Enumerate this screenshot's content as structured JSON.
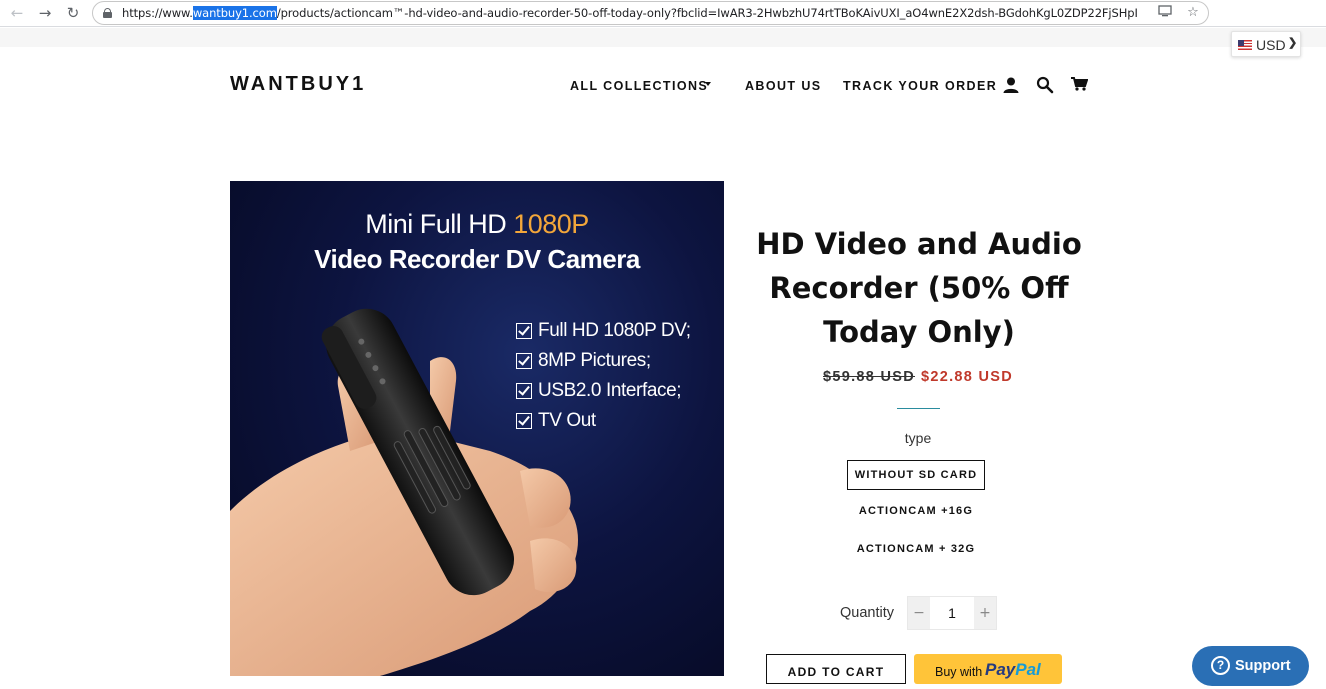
{
  "browser": {
    "url_prefix": "https://www.",
    "url_highlight": "wantbuy1.com",
    "url_rest": "/products/actioncam™-hd-video-and-audio-recorder-50-off-today-only?fbclid=IwAR3-2HwbzhU74rtTBoKAivUXI_aO4wnE2X2dsh-BGdohKgL0ZDP22FjSHpI",
    "icons": {
      "back": "arrow-left-icon",
      "forward": "arrow-right-icon",
      "reload": "reload-icon",
      "lock": "lock-icon",
      "cast": "cast-icon",
      "bookmark": "star-icon"
    }
  },
  "currency": {
    "label": "USD",
    "flag": "us-flag-icon"
  },
  "header": {
    "logo": "WANTBUY1",
    "nav": {
      "collections": "ALL COLLECTIONS",
      "about": "ABOUT US",
      "track": "TRACK YOUR ORDER"
    },
    "icons": {
      "account": "user-icon",
      "search": "search-icon",
      "cart": "cart-icon"
    }
  },
  "product": {
    "image": {
      "title_line1_prefix": "Mini Full HD ",
      "title_line1_accent": "1080P",
      "title_line2": "Video Recorder DV Camera",
      "features": [
        "Full HD 1080P DV;",
        "8MP Pictures;",
        "USB2.0 Interface;",
        "TV Out"
      ]
    },
    "title": "HD Video and Audio Recorder (50% Off Today Only)",
    "price_old": "$59.88 USD",
    "price_new": "$22.88 USD",
    "option_label": "type",
    "variants": [
      "WITHOUT SD CARD",
      "ACTIONCAM +16G",
      "ACTIONCAM + 32G"
    ],
    "selected_variant": "WITHOUT SD CARD",
    "quantity_label": "Quantity",
    "quantity": "1",
    "qty_minus": "−",
    "qty_plus": "+",
    "add_to_cart": "ADD TO CART",
    "paypal_prefix": "Buy with",
    "paypal_pay": "Pay",
    "paypal_pal": "Pal"
  },
  "support": {
    "label": "Support",
    "icon": "?"
  },
  "colors": {
    "sale_price": "#c0392b",
    "paypal": "#ffc439",
    "support": "#2a6fb5",
    "divider": "#2a8c9e"
  }
}
